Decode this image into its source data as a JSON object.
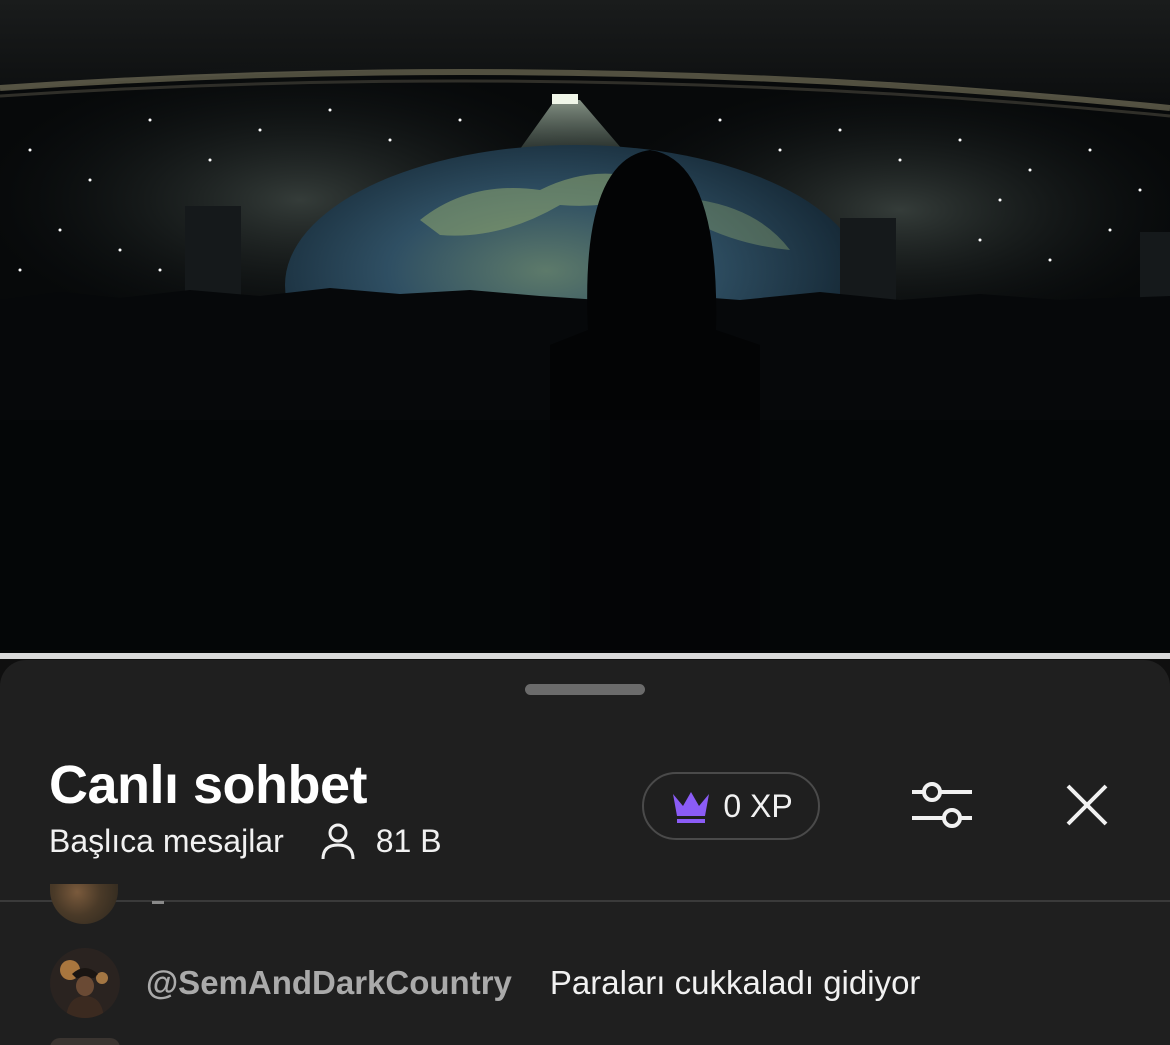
{
  "player": {
    "progress_fraction": 1.0
  },
  "chat": {
    "title": "Canlı sohbet",
    "mode_label": "Başlıca mesajlar",
    "viewer_count": "81 B",
    "xp_label": "0 XP",
    "icons": {
      "viewers": "person-icon",
      "xp": "crown-icon",
      "filter": "sliders-icon",
      "close": "close-icon"
    },
    "colors": {
      "sheet_background": "#1f1f1f",
      "crown": "#8b5cf6",
      "author": "#aaaaaa",
      "text": "#f1f1f1"
    },
    "messages": [
      {
        "author": "@SemAndDarkCountry",
        "text": "Paraları cukkaladı gidiyor"
      }
    ]
  }
}
